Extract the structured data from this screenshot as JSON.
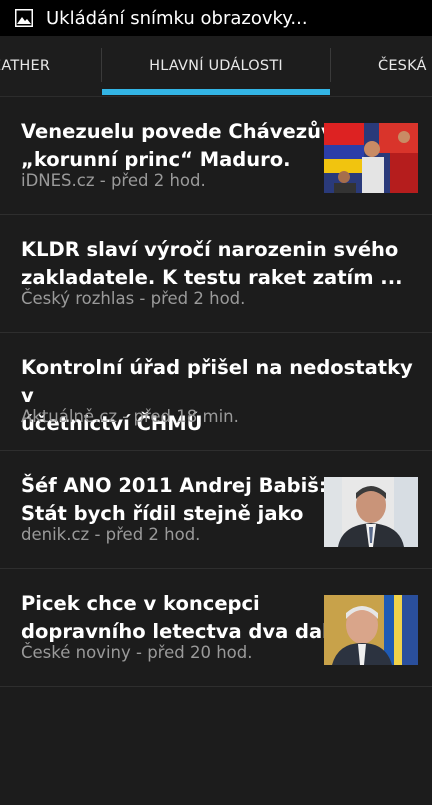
{
  "status_bar": {
    "icon": "image-icon",
    "text": "Ukládání snímku obrazovky..."
  },
  "tabs": {
    "left": "EATHER",
    "center": "HLAVNÍ UDÁLOSTI",
    "right": "ČESKÁ R",
    "active_color": "#33b5e5"
  },
  "news": [
    {
      "title_line1": "Venezuelu povede Chávezův",
      "title_line2": "„korunní princ“ Maduro.",
      "source": "iDNES.cz - před 2 hod.",
      "has_thumb": true
    },
    {
      "title_line1": "KLDR slaví výročí narozenin svého",
      "title_line2": "zakladatele. K testu raket zatím ...",
      "source": "Český rozhlas - před 2 hod.",
      "has_thumb": false
    },
    {
      "title_line1": "Kontrolní úřad přišel na nedostatky v",
      "title_line2": "účetnictví ČHMÚ",
      "source": "Aktuálně.cz - před 18 min.",
      "has_thumb": false
    },
    {
      "title_line1": "Šéf ANO 2011 Andrej Babiš:",
      "title_line2": "Stát bych řídil stejně jako",
      "source": "denik.cz - před 2 hod.",
      "has_thumb": true
    },
    {
      "title_line1": "Picek chce v koncepci",
      "title_line2": "dopravního letectva dva další",
      "source": "České noviny - před 20 hod.",
      "has_thumb": true
    }
  ]
}
